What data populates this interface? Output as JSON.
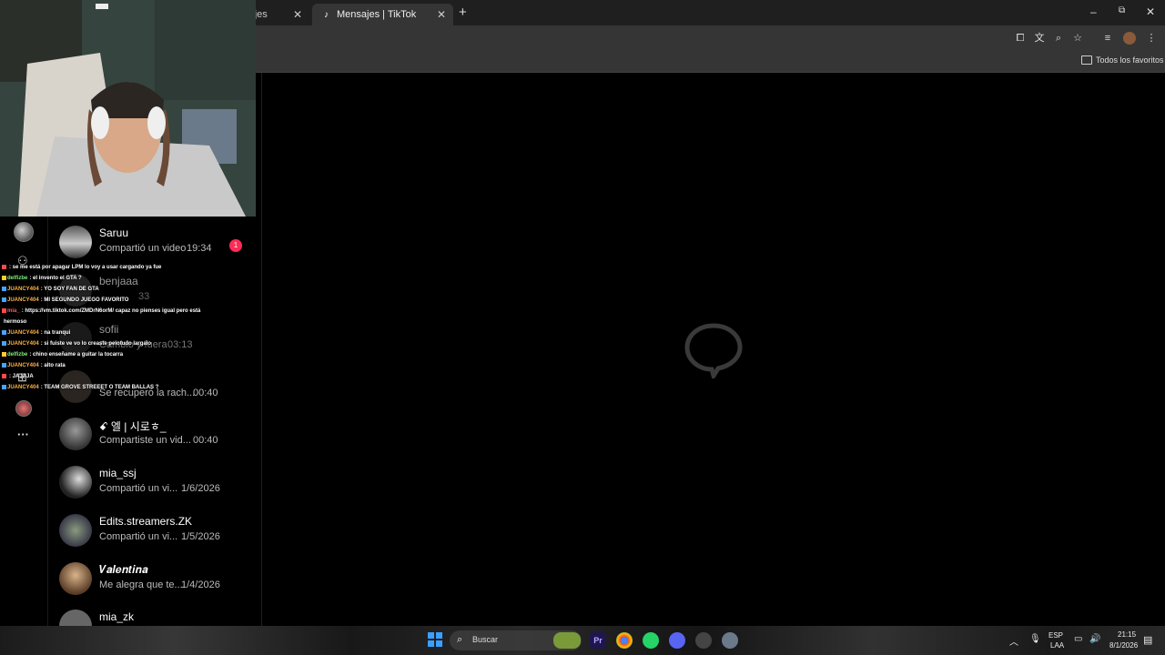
{
  "browser": {
    "tabs": [
      {
        "title": "nsajes"
      },
      {
        "title": "Mensajes | TikTok"
      }
    ],
    "new_tab_icon": "+",
    "window_controls": {
      "minimize": "–",
      "restore": "⧉",
      "close": "✕"
    },
    "bookmarks": {
      "folder_label": "Todos los favoritos"
    }
  },
  "tiktok": {
    "unread_badge": "1",
    "conversations": [
      {
        "name": "Saruu",
        "preview": "Compartió un video",
        "time": "19:34"
      },
      {
        "name": "benjaaa",
        "preview": "",
        "time": "33"
      },
      {
        "name": "sofii",
        "preview": "Cambio y fuera",
        "time": "03:13"
      },
      {
        "name": "",
        "preview": "Se recuperó la rach...",
        "time": "00:40"
      },
      {
        "name": "ꗃ 엘 | 시로ㅎ_",
        "preview": "Compartiste un vid...",
        "time": "00:40"
      },
      {
        "name": "mia_ssj",
        "preview": "Compartió un vi...",
        "time": "1/6/2026"
      },
      {
        "name": "Edits.streamers.ZK",
        "preview": "Compartió un vi...",
        "time": "1/5/2026"
      },
      {
        "name": "𝑽𝒂𝒍𝒆𝒏𝒕𝒊𝒏𝒂",
        "preview": "Me alegra que te...",
        "time": "1/4/2026"
      },
      {
        "name": "mia_zk",
        "preview": "",
        "time": ""
      }
    ]
  },
  "stream_chat": [
    {
      "user": "",
      "user_color": "#ff5a5a",
      "msg": ": se me está por apagar LPM lo voy a usar cargando ya fue"
    },
    {
      "user": "delfizbe",
      "user_color": "#7cf07c",
      "msg": ": el invento el GTA ?"
    },
    {
      "user": "JUANCY404",
      "user_color": "#ffb347",
      "msg": ": YO SOY FAN DE GTA"
    },
    {
      "user": "JUANCY404",
      "user_color": "#ffb347",
      "msg": ": MI SEGUNDO JUEGO FAVORITO"
    },
    {
      "user": "mia_",
      "user_color": "#ff5a5a",
      "msg": ": https://vm.tiktok.com/ZMDrN6orM/ capaz no pienses igual pero está"
    },
    {
      "user": "",
      "user_color": "#ffffff",
      "msg": "hermoso"
    },
    {
      "user": "JUANCY404",
      "user_color": "#ffb347",
      "msg": ": na tranqui"
    },
    {
      "user": "JUANCY404",
      "user_color": "#ffb347",
      "msg": ": si fuiste ve vo lo creaste pelotudo largalo"
    },
    {
      "user": "delfizbe",
      "user_color": "#7cf07c",
      "msg": ": chino enseñame a guitar la tocarra"
    },
    {
      "user": "JUANCY404",
      "user_color": "#ffb347",
      "msg": ": alto rata"
    },
    {
      "user": "",
      "user_color": "#ff5a5a",
      "msg": ": JAJAJA"
    },
    {
      "user": "JUANCY404",
      "user_color": "#ffb347",
      "msg": ": TEAM GROVE STREEET O TEAM BALLAS ?"
    }
  ],
  "taskbar": {
    "search_label": "Buscar",
    "language": "ESP",
    "language_sub": "LAA",
    "time": "21:15",
    "date": "8/1/2026"
  },
  "colors": {
    "tiktok_red": "#fe2c55",
    "windows_blue": "#3aa0ff"
  }
}
